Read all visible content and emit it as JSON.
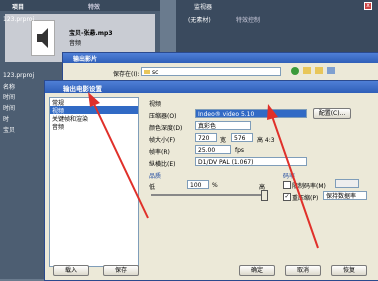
{
  "project_panel": {
    "title": "项目",
    "tab_effects": "特效",
    "clip_name": "宝贝-张悬.mp3",
    "clip_type": "音频",
    "project_file": "123.prproj",
    "list_item": "123.prproj",
    "col_name": "名称",
    "rows": [
      "时间",
      "时间",
      "时",
      "宝贝"
    ]
  },
  "monitor_panel": {
    "title": "监视器",
    "tab_source": "(无素材)",
    "tab_effect": "特效控制"
  },
  "export_clip": {
    "title": "输出影片",
    "save_in_label": "保存在(I):",
    "save_in_value": "sc"
  },
  "settings_dialog": {
    "title": "输出电影设置",
    "left_list": [
      "常规",
      "视频",
      "关键帧和渲染",
      "音频"
    ],
    "section_video": "视频",
    "compressor_label": "压缩器(O)",
    "compressor_value": "Indeo® video 5.10",
    "config_button": "配置(C)...",
    "color_depth_label": "颜色深度(D)",
    "color_depth_value": "真彩色",
    "frame_size_label": "帧大小(F)",
    "frame_w": "720",
    "frame_w_unit": "宽",
    "frame_h": "576",
    "frame_h_unit": "高 4:3",
    "frame_rate_label": "帧率(R)",
    "frame_rate_value": "25.00",
    "frame_rate_unit": "fps",
    "pixel_aspect_label": "纵横比(E)",
    "pixel_aspect_value": "D1/DV PAL (1.067)",
    "quality_section": "品质",
    "quality_low": "低",
    "quality_value": "100",
    "quality_pct": "%",
    "quality_high": "高",
    "bitrate_section": "码率",
    "limit_bitrate_label": "限制码率(M)",
    "recompress_label": "重压缩(P)",
    "recompress_value": "保持数据率",
    "btn_load": "载入",
    "btn_save": "保存",
    "btn_ok": "确定",
    "btn_cancel": "取消",
    "btn_restore": "恢复"
  }
}
